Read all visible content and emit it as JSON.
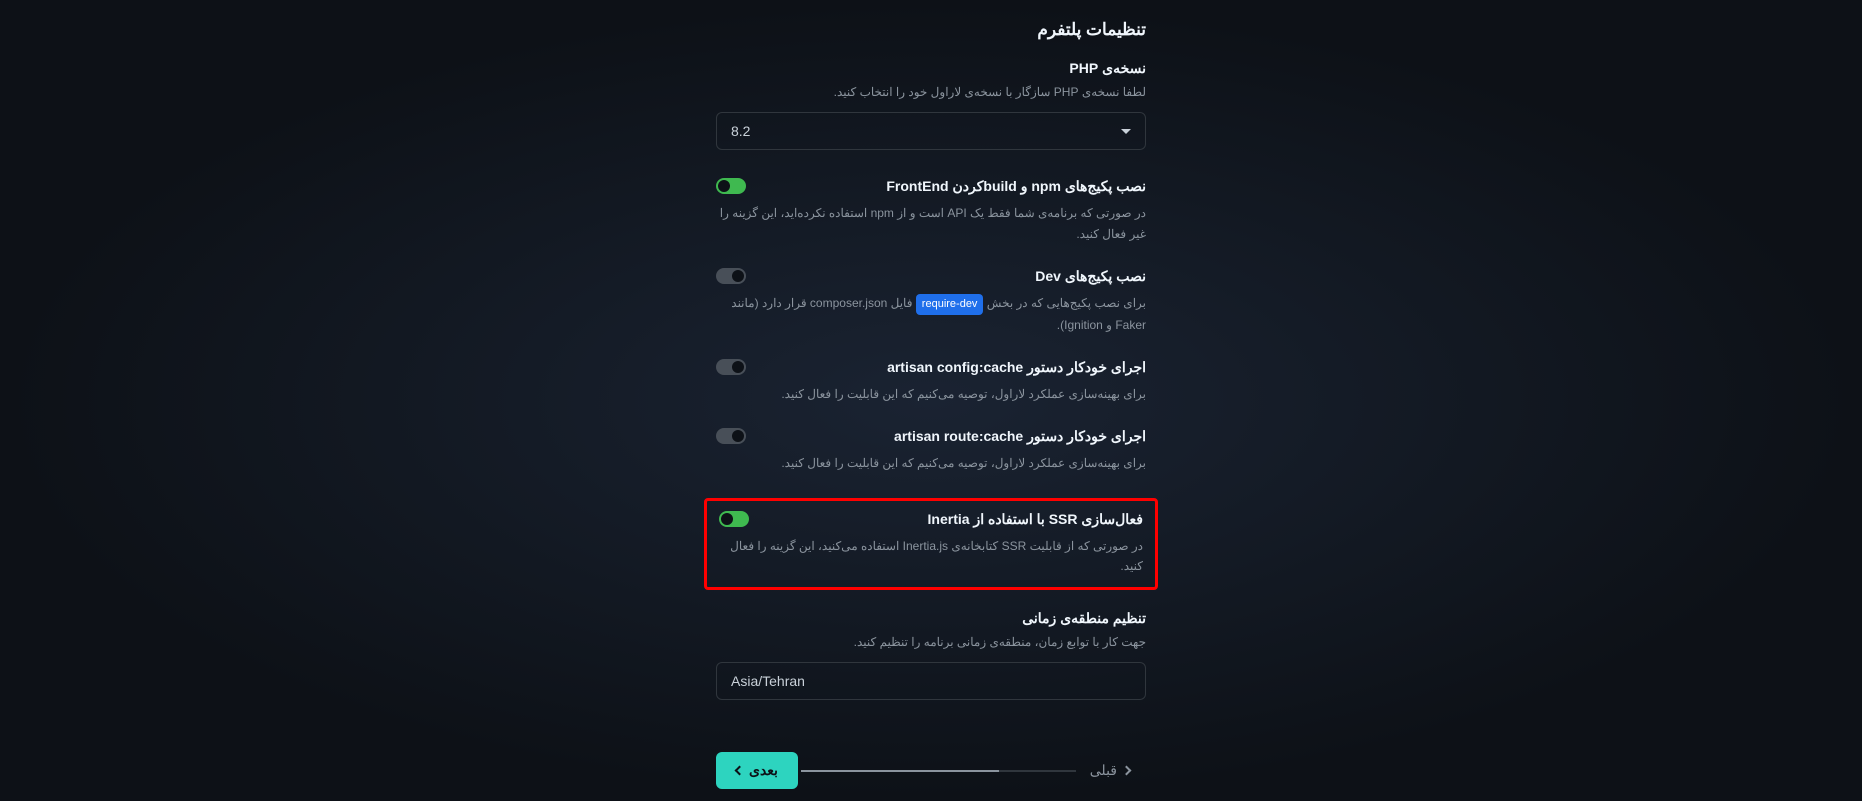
{
  "page_title": "تنظیمات پلتفرم",
  "php_version": {
    "label": "نسخه‌ی PHP",
    "description": "لطفا نسخه‌ی PHP سازگار با نسخه‌ی لاراول خود را انتخاب کنید.",
    "value": "8.2"
  },
  "npm_build": {
    "title": "نصب پکیج‌های npm و buildکردن FrontEnd",
    "description": "در صورتی که برنامه‌ی شما فقط یک API است و از npm استفاده نکرده‌اید، این گزینه را غیر فعال کنید.",
    "enabled": true
  },
  "dev_packages": {
    "title": "نصب پکیج‌های Dev",
    "description_before": "برای نصب پکیج‌هایی که در بخش ",
    "code_tag": "require-dev",
    "description_after": " فایل composer.json قرار دارد (مانند Faker و Ignition).",
    "enabled": false
  },
  "config_cache": {
    "title": "اجرای خودکار دستور artisan config:cache",
    "description": "برای بهینه‌سازی عملکرد لاراول، توصیه می‌کنیم که این قابلیت را فعال کنید.",
    "enabled": false
  },
  "route_cache": {
    "title": "اجرای خودکار دستور artisan route:cache",
    "description": "برای بهینه‌سازی عملکرد لاراول، توصیه می‌کنیم که این قابلیت را فعال کنید.",
    "enabled": false
  },
  "inertia_ssr": {
    "title": "فعال‌سازی SSR با استفاده از Inertia",
    "description": "در صورتی که از قابلیت SSR کتابخانه‌ی Inertia.js استفاده می‌کنید، این گزینه را فعال کنید.",
    "enabled": true
  },
  "timezone": {
    "label": "تنظیم منطقه‌ی زمانی",
    "description": "جهت کار با توابع زمان، منطقه‌ی زمانی برنامه را تنظیم کنید.",
    "value": "Asia/Tehran"
  },
  "nav": {
    "prev": "قبلی",
    "next": "بعدی"
  }
}
